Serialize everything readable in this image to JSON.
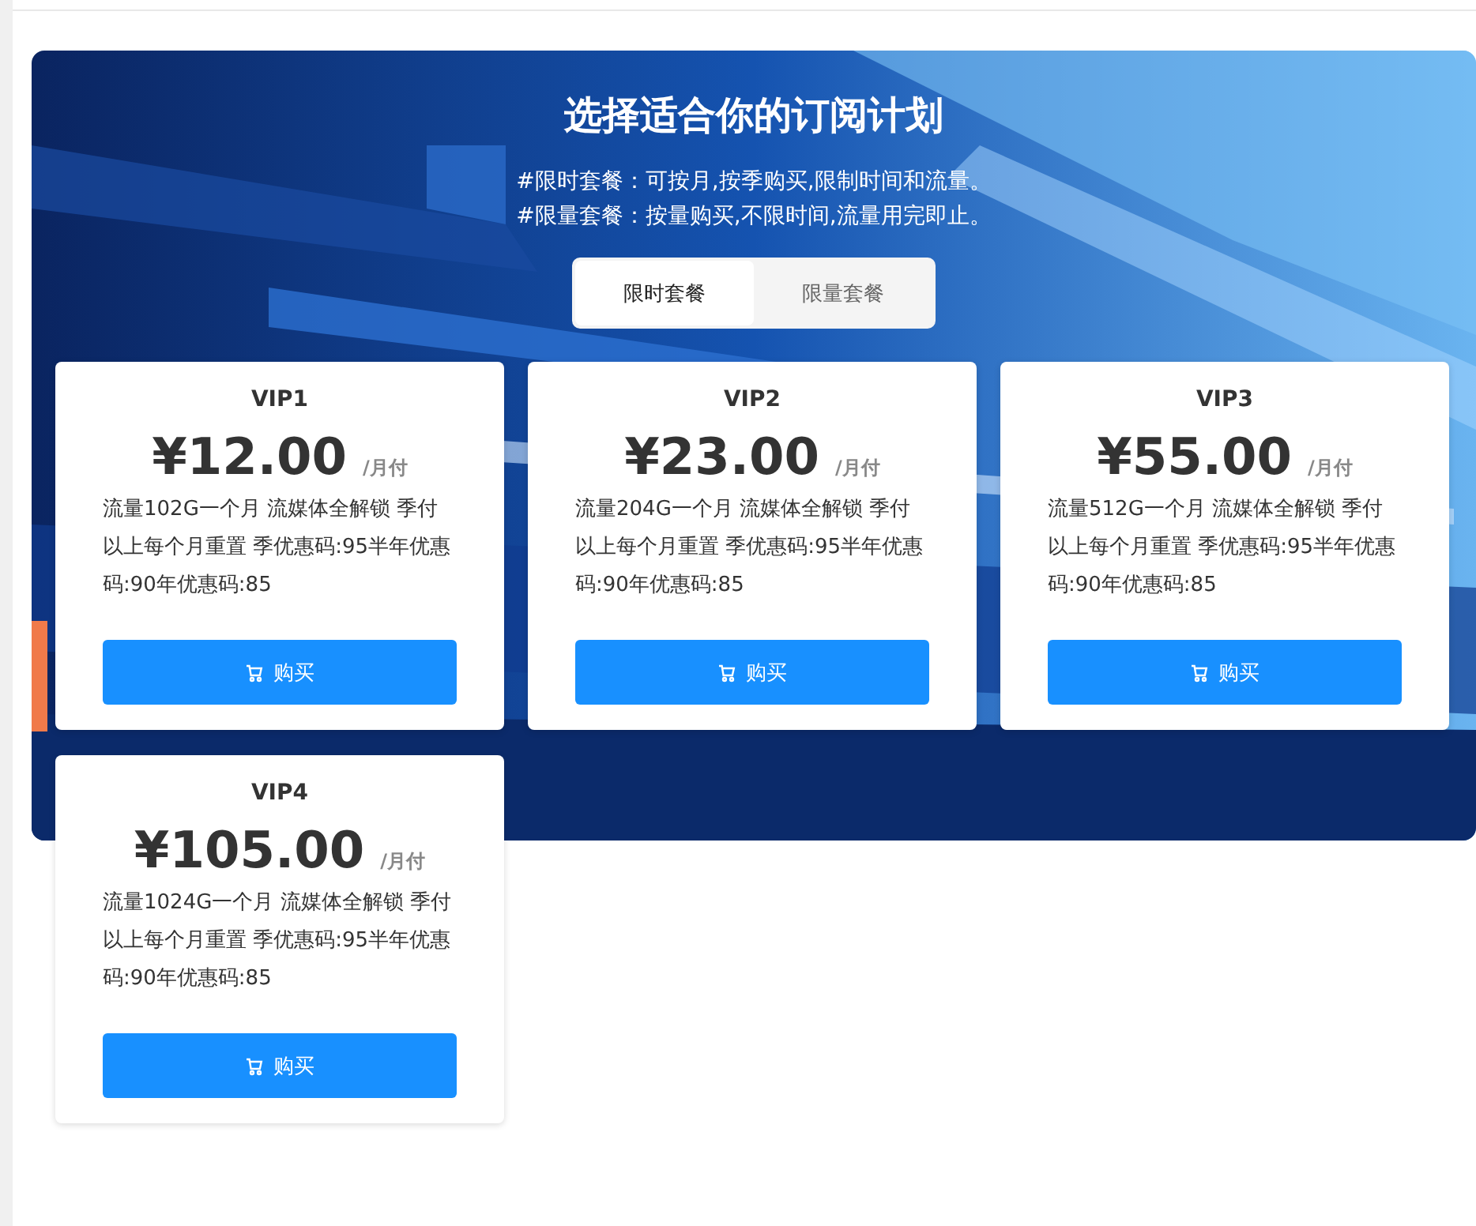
{
  "hero": {
    "title": "选择适合你的订阅计划",
    "notes": [
      "#限时套餐：可按月,按季购买,限制时间和流量。",
      "#限量套餐：按量购买,不限时间,流量用完即止。"
    ]
  },
  "tabs": [
    {
      "label": "限时套餐",
      "selected": true
    },
    {
      "label": "限量套餐",
      "selected": false
    }
  ],
  "plans": [
    {
      "name": "VIP1",
      "price": "¥12.00",
      "period": "/月付",
      "description": "流量102G一个月 流媒体全解锁 季付以上每个月重置 季优惠码:95半年优惠码:90年优惠码:85",
      "button": "购买"
    },
    {
      "name": "VIP2",
      "price": "¥23.00",
      "period": "/月付",
      "description": "流量204G一个月 流媒体全解锁 季付以上每个月重置 季优惠码:95半年优惠码:90年优惠码:85",
      "button": "购买"
    },
    {
      "name": "VIP3",
      "price": "¥55.00",
      "period": "/月付",
      "description": "流量512G一个月 流媒体全解锁 季付以上每个月重置 季优惠码:95半年优惠码:90年优惠码:85",
      "button": "购买"
    },
    {
      "name": "VIP4",
      "price": "¥105.00",
      "period": "/月付",
      "description": "流量1024G一个月 流媒体全解锁 季付以上每个月重置 季优惠码:95半年优惠码:90年优惠码:85",
      "button": "购买"
    }
  ]
}
